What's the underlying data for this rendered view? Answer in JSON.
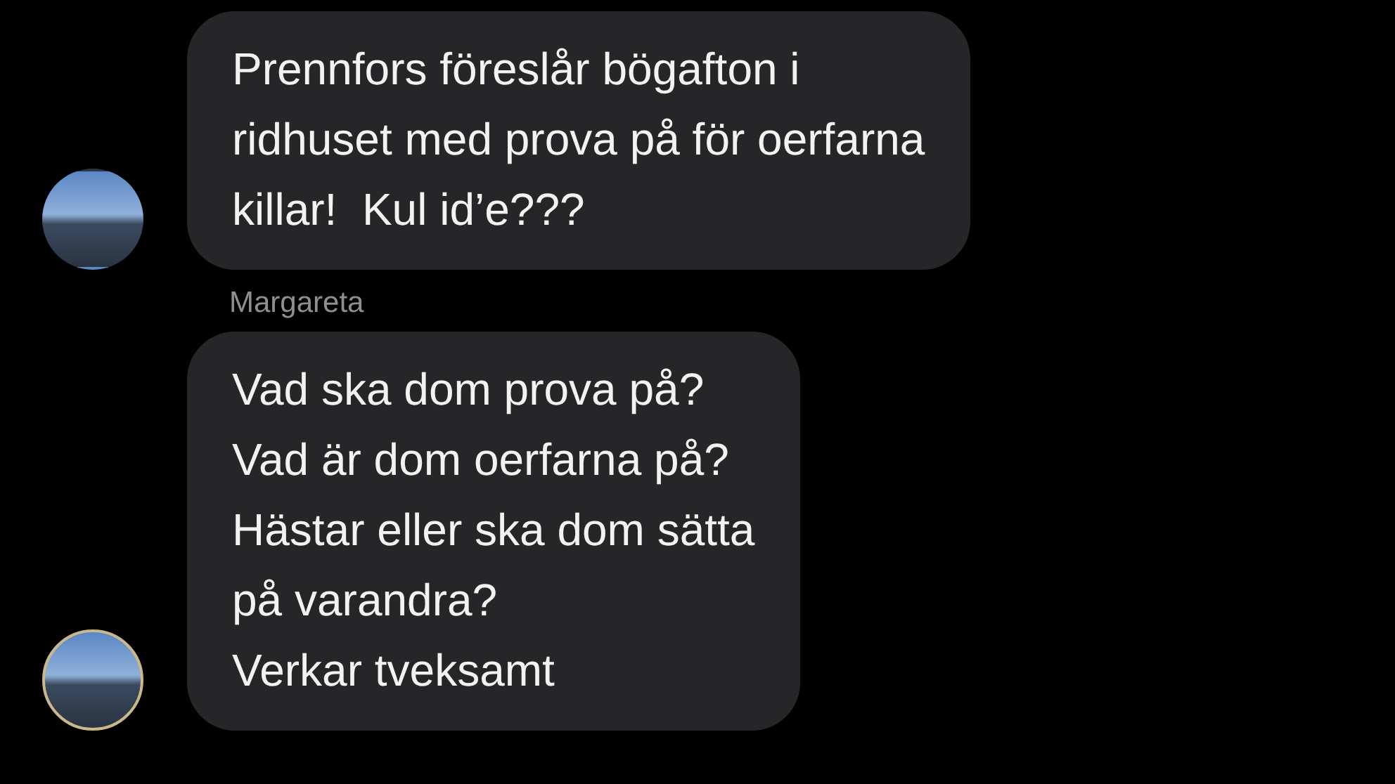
{
  "messages": [
    {
      "lines": [
        "Prennfors föreslår bögafton i",
        "ridhuset med prova på för oerfarna",
        "killar!  Kul id’e???"
      ]
    },
    {
      "sender": "Margareta",
      "lines": [
        "Vad ska dom prova på?",
        "Vad är dom oerfarna på?",
        "Hästar eller ska dom sätta",
        "på varandra?",
        "Verkar tveksamt"
      ]
    }
  ]
}
